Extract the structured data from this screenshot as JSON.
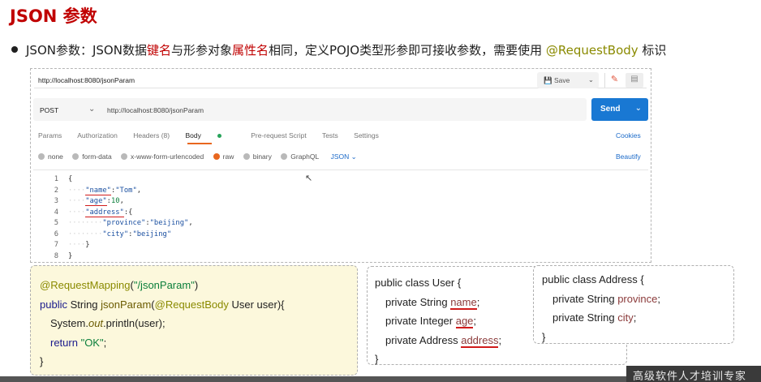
{
  "slide": {
    "title": "JSON 参数",
    "bullet": {
      "prefix": "JSON参数：JSON数据",
      "kw1": "键名",
      "mid": "与形参对象",
      "kw2": "属性名",
      "suffix": "相同，定义POJO类型形参即可接收参数，需要使用 ",
      "annotation": "@RequestBody",
      "tail": " 标识"
    }
  },
  "postman": {
    "tab_url": "http://localhost:8080/jsonParam",
    "save_label": "Save",
    "method": "POST",
    "url": "http://localhost:8080/jsonParam",
    "send_label": "Send",
    "tabs": [
      "Params",
      "Authorization",
      "Headers (8)",
      "Body",
      "Pre-request Script",
      "Tests",
      "Settings"
    ],
    "cookies_label": "Cookies",
    "body_options": [
      "none",
      "form-data",
      "x-www-form-urlencoded",
      "raw",
      "binary",
      "GraphQL"
    ],
    "format": "JSON",
    "beautify_label": "Beautify",
    "code": {
      "line_numbers": [
        "1",
        "2",
        "3",
        "4",
        "5",
        "6",
        "7",
        "8"
      ],
      "open_brace": "{",
      "k_name": "\"name\"",
      "v_name": "\"Tom\"",
      "k_age": "\"age\"",
      "v_age": "10",
      "k_address": "\"address\"",
      "k_province": "\"province\"",
      "v_province": "\"beijing\"",
      "k_city": "\"city\"",
      "v_city": "\"beijing\"",
      "close_brace": "}"
    }
  },
  "controller_box": {
    "annotation": "@RequestMapping",
    "path": "\"/jsonParam\"",
    "sig_public": "public ",
    "sig_type": "String ",
    "sig_method": "jsonParam",
    "sig_param_ann": "@RequestBody",
    "sig_param": " User user){",
    "sys": "System.",
    "out": "out",
    "println": ".println(user);",
    "return_kw": "return ",
    "return_val": "\"OK\"",
    "close": "}"
  },
  "user_box": {
    "header": "public class User {",
    "f1_prefix": "private String ",
    "f1_name": "name",
    "f2_prefix": "private Integer ",
    "f2_name": "age",
    "f3_prefix": "private Address ",
    "f3_name": "address",
    "close": "}"
  },
  "address_box": {
    "header": "public class Address {",
    "f1_prefix": "private String ",
    "f1_name": "province",
    "f2_prefix": "private String ",
    "f2_name": "city",
    "close": "}"
  },
  "watermark": "高级软件人才培训专家",
  "colors": {
    "title_red": "#c00000",
    "send_blue": "#1978d3",
    "accent_orange": "#e8671f",
    "annotation_olive": "#8a8a00"
  }
}
